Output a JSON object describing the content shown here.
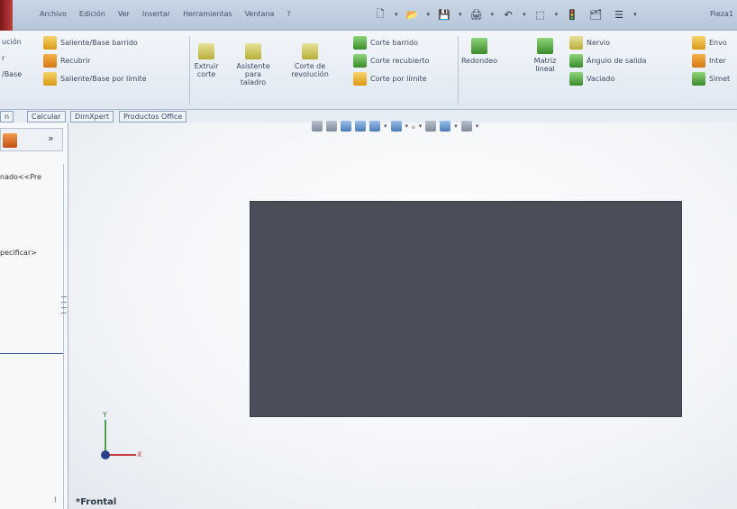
{
  "menubar": {
    "items": [
      "Archivo",
      "Edición",
      "Ver",
      "Insertar",
      "Herramientas",
      "Ventana",
      "?"
    ],
    "doc_title": "Pieza1"
  },
  "ribbon": {
    "left_col": [
      "ución",
      "r",
      "/Base"
    ],
    "group1": [
      "Saliente/Base barrido",
      "Recubrir",
      "Saliente/Base por límite"
    ],
    "big_buttons": [
      {
        "label": "Extruir corte"
      },
      {
        "label": "Asistente para taladro"
      },
      {
        "label": "Corte de revolución"
      }
    ],
    "group2": [
      "Corte barrido",
      "Corte recubierto",
      "Corte por límite"
    ],
    "features": [
      "Redondeo",
      "Matriz lineal"
    ],
    "group3": [
      "Nervio",
      "Ángulo de salida",
      "Vaciado"
    ],
    "group4": [
      "Envo",
      "Inter",
      "Simet"
    ]
  },
  "tabs": [
    "n",
    "Calcular",
    "DimXpert",
    "Productos Office"
  ],
  "left_pane": {
    "more": "»",
    "line1": "nado<<Pre",
    "line2": "pecificar>",
    "scroll": "⁞"
  },
  "viewport": {
    "triad_y": "Y",
    "triad_x": "X",
    "view_name": "*Frontal"
  },
  "colors": {
    "shape_fill": "#4b4e59",
    "ribbon_bg": "#dfe7f1"
  }
}
